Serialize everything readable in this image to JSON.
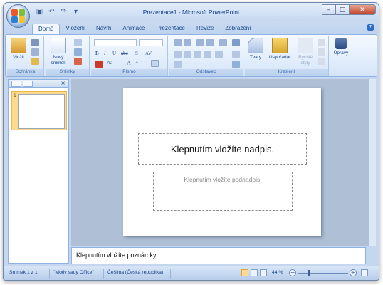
{
  "window": {
    "title": "Prezentace1 - Microsoft PowerPoint"
  },
  "quick_access": {
    "icons": [
      "save-icon",
      "undo-icon",
      "redo-icon",
      "customize-icon"
    ],
    "glyphs": [
      "▣",
      "↶",
      "↷",
      "▾"
    ]
  },
  "window_controls": {
    "minimize": "–",
    "maximize": "▢",
    "close": "✕"
  },
  "tabs": [
    {
      "label": "Domů",
      "active": true
    },
    {
      "label": "Vložení"
    },
    {
      "label": "Návrh"
    },
    {
      "label": "Animace"
    },
    {
      "label": "Prezentace"
    },
    {
      "label": "Revize"
    },
    {
      "label": "Zobrazení"
    }
  ],
  "help_glyph": "?",
  "ribbon": {
    "groups": [
      {
        "label": "Schránka",
        "buttons": [
          "Vložit"
        ]
      },
      {
        "label": "Snímky",
        "buttons": [
          "Nový snímek"
        ]
      },
      {
        "label": "Písmo",
        "buttons": [
          "B",
          "I",
          "U",
          "abc",
          "S",
          "AV",
          "Aa",
          "A",
          "A"
        ]
      },
      {
        "label": "Odstavec",
        "buttons": []
      },
      {
        "label": "Kreslení",
        "buttons": [
          "Tvary",
          "Uspořádat",
          "Rychlé styly"
        ]
      },
      {
        "label": "Úpravy",
        "buttons": []
      }
    ]
  },
  "slide_pane": {
    "slide_number": "1",
    "close_glyph": "×"
  },
  "slide": {
    "title_placeholder": "Klepnutím vložíte nadpis.",
    "subtitle_placeholder": "Klepnutím vložíte podnadpis."
  },
  "notes": {
    "placeholder": "Klepnutím vložíte poznámky."
  },
  "status": {
    "slide_count": "Snímek 1 z 1",
    "theme": "\"Motiv sady Office\"",
    "language": "Čeština (Česká republika)",
    "zoom": "44 %",
    "zoom_fraction": 0.44
  },
  "colors": {
    "ribbon_text": "#15428b",
    "selection": "#ffd98e",
    "close_button": "#c0432b"
  }
}
